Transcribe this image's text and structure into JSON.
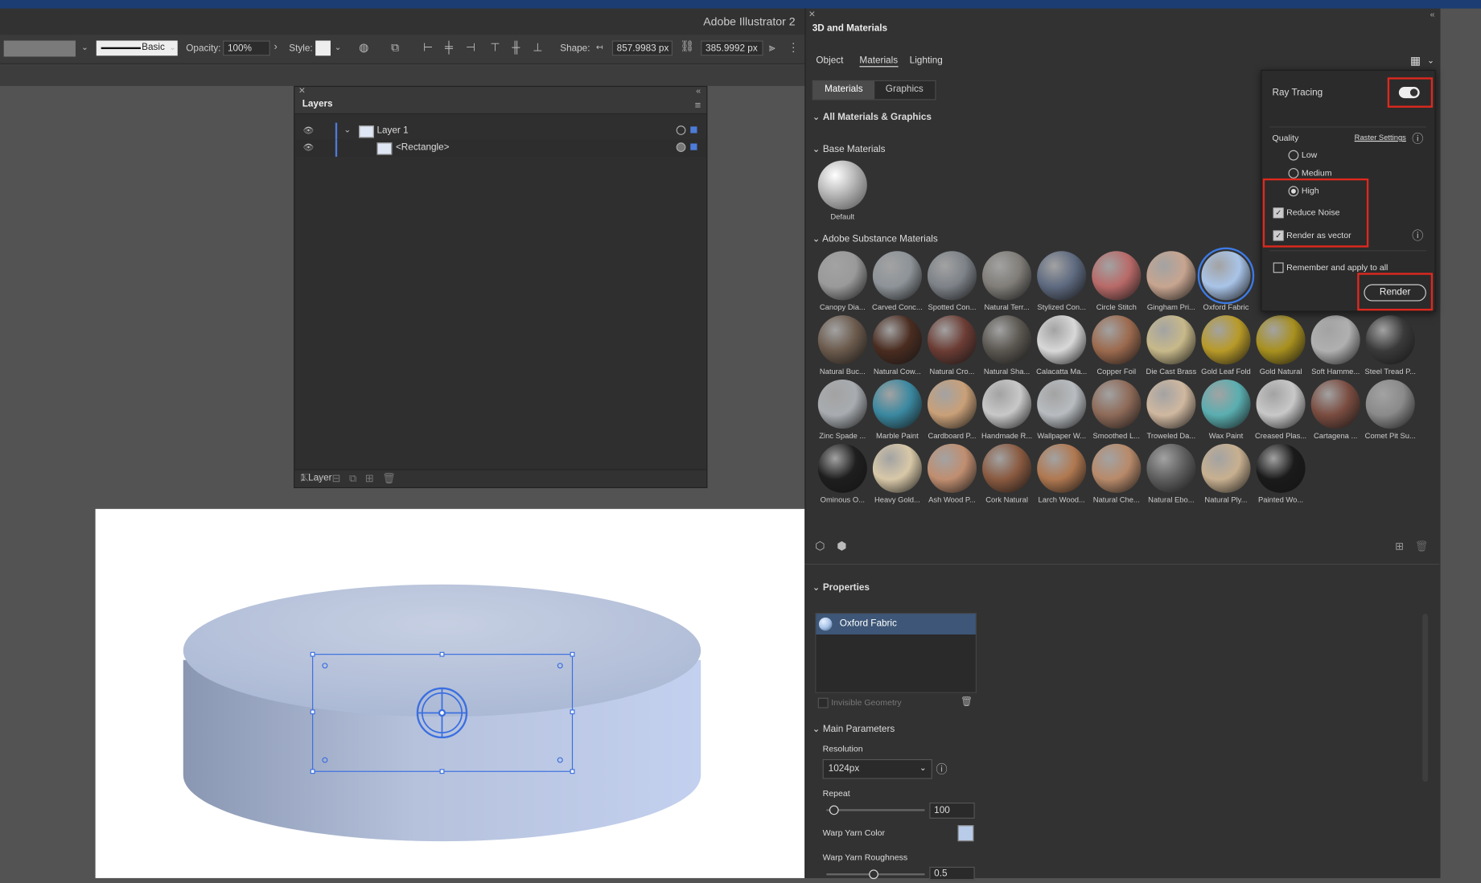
{
  "app": {
    "title": "Adobe Illustrator 2"
  },
  "control_bar": {
    "stroke_style": "Basic",
    "opacity_label": "Opacity:",
    "opacity_value": "100%",
    "style_label": "Style:",
    "shape_label": "Shape:",
    "width_value": "857.9983 px",
    "height_value": "385.9992 px"
  },
  "layers_panel": {
    "tab": "Layers",
    "rows": [
      {
        "name": "Layer 1"
      },
      {
        "name": "<Rectangle>"
      }
    ],
    "footer": "1 Layer"
  },
  "materials_panel": {
    "title": "3D and Materials",
    "tabs": [
      "Object",
      "Materials",
      "Lighting"
    ],
    "active_tab": "Materials",
    "sub_tabs": [
      "Materials",
      "Graphics"
    ],
    "all_section": "All Materials & Graphics",
    "base_section": "Base Materials",
    "base_default": "Default",
    "substance_section": "Adobe Substance Materials",
    "materials": [
      {
        "label": "Canopy Dia...",
        "color": "#9a9a9a"
      },
      {
        "label": "Carved Conc...",
        "color": "#8d9398"
      },
      {
        "label": "Spotted Con...",
        "color": "#7d8288"
      },
      {
        "label": "Natural Terr...",
        "color": "#807d78"
      },
      {
        "label": "Stylized Con...",
        "color": "#5e6a80"
      },
      {
        "label": "Circle Stitch",
        "color": "#b86a68"
      },
      {
        "label": "Gingham Pri...",
        "color": "#c7a590"
      },
      {
        "label": "Oxford Fabric",
        "color": "#a9c4e8"
      },
      {
        "label": "Natural Buc...",
        "color": "#6b5a4c"
      },
      {
        "label": "Natural Cow...",
        "color": "#4a2c20"
      },
      {
        "label": "Natural Cro...",
        "color": "#6b3c34"
      },
      {
        "label": "Natural Sha...",
        "color": "#5a5650"
      },
      {
        "label": "Calacatta Ma...",
        "color": "#d8d8d8"
      },
      {
        "label": "Copper Foil",
        "color": "#9c6a4e"
      },
      {
        "label": "Die Cast Brass",
        "color": "#c8b98a"
      },
      {
        "label": "Gold Leaf Fold",
        "color": "#b89a28"
      },
      {
        "label": "Gold Natural",
        "color": "#a8901e"
      },
      {
        "label": "Soft Hamme...",
        "color": "#b0b0b0"
      },
      {
        "label": "Steel Tread P...",
        "color": "#3a3a3a"
      },
      {
        "label": "Zinc Spade ...",
        "color": "#a8acb0"
      },
      {
        "label": "Marble Paint",
        "color": "#3a88a0"
      },
      {
        "label": "Cardboard P...",
        "color": "#c9a078"
      },
      {
        "label": "Handmade R...",
        "color": "#c8c8c8"
      },
      {
        "label": "Wallpaper W...",
        "color": "#b8bcc0"
      },
      {
        "label": "Smoothed L...",
        "color": "#8e6a58"
      },
      {
        "label": "Troweled Da...",
        "color": "#d0b8a0"
      },
      {
        "label": "Wax Paint",
        "color": "#5aaeb0"
      },
      {
        "label": "Creased Plas...",
        "color": "#c8c8c8"
      },
      {
        "label": "Cartagena ...",
        "color": "#7a4c40"
      },
      {
        "label": "Comet Pit Su...",
        "color": "#8a8a8a"
      },
      {
        "label": "Ominous O...",
        "color": "#1e1e1e"
      },
      {
        "label": "Heavy Gold...",
        "color": "#d8c8a8"
      },
      {
        "label": "Ash Wood P...",
        "color": "#c08e70"
      },
      {
        "label": "Cork Natural",
        "color": "#8a5a40"
      },
      {
        "label": "Larch Wood...",
        "color": "#b07850"
      },
      {
        "label": "Natural Che...",
        "color": "#b88a6a"
      },
      {
        "label": "Natural Ebo...",
        "color": "#5e5e5e"
      },
      {
        "label": "Natural Ply...",
        "color": "#c8b090"
      },
      {
        "label": "Painted Wo...",
        "color": "#1a1a1a"
      }
    ],
    "properties_section": "Properties",
    "selected_material": "Oxford Fabric",
    "invisible_geometry": "Invisible Geometry",
    "main_parameters": "Main Parameters",
    "resolution_label": "Resolution",
    "resolution_value": "1024px",
    "repeat_label": "Repeat",
    "repeat_value": "100",
    "warp_color_label": "Warp Yarn Color",
    "warp_color": "#b8cbe8",
    "warp_rough_label": "Warp Yarn Roughness",
    "warp_rough_value": "0.5"
  },
  "render_popup": {
    "ray_tracing": "Ray Tracing",
    "ray_tracing_on": true,
    "quality": "Quality",
    "raster_settings": "Raster Settings",
    "options": [
      "Low",
      "Medium",
      "High"
    ],
    "selected": "High",
    "reduce_noise": "Reduce Noise",
    "reduce_noise_checked": true,
    "render_vector": "Render as vector",
    "render_vector_checked": true,
    "remember": "Remember and apply to all",
    "remember_checked": false,
    "render_button": "Render"
  },
  "colors": {
    "highlight": "#e0281e",
    "selection": "#4d7bd8",
    "menubar": "#1c3d73"
  }
}
